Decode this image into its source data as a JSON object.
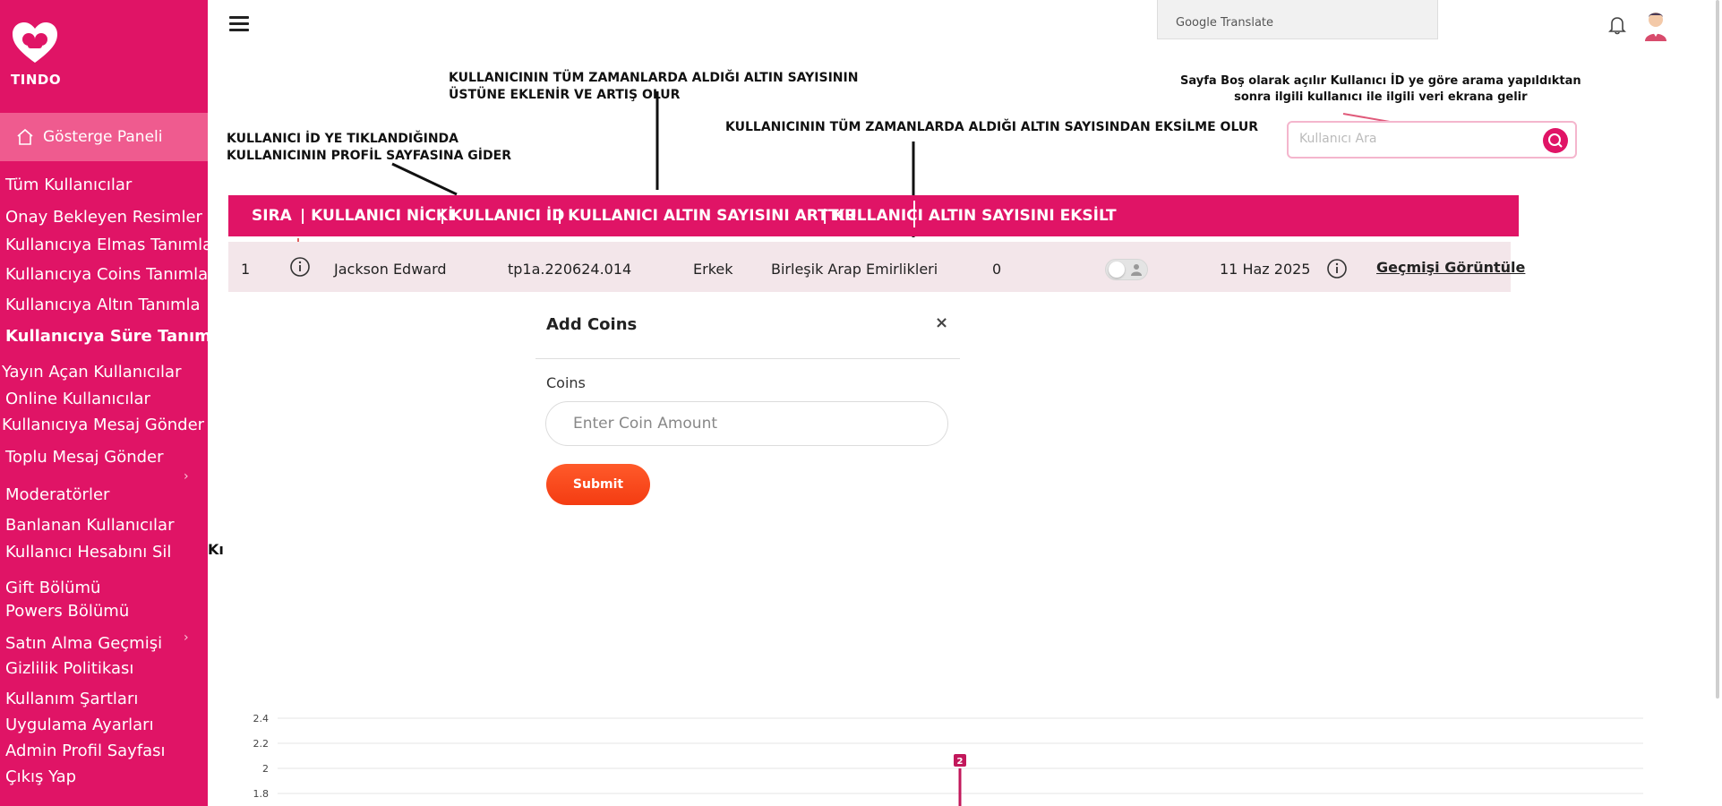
{
  "app": {
    "brand": "TINDO"
  },
  "sidebar": {
    "active_label": "Gösterge Paneli",
    "items": [
      "Tüm Kullanıcılar",
      "Onay Bekleyen Resimler",
      "Kullanıcıya Elmas Tanımla",
      "Kullanıcıya Coins Tanımla",
      "Kullanıcıya Altın Tanımla",
      "Kullanıcıya Süre Tanımla",
      "Yayın Açan Kullanıcılar",
      "Online Kullanıcılar",
      "Kullanıcıya Mesaj Gönder",
      "Toplu Mesaj Gönder",
      "Moderatörler",
      "Banlanan Kullanıcılar",
      "Kullanıcı Hesabını Sil",
      "Gift Bölümü",
      "Powers Bölümü",
      "Satın Alma Geçmişi",
      "Gizlilik Politikası",
      "Kullanım Şartları",
      "Uygulama Ayarları",
      "Admin Profil Sayfası",
      "Çıkış Yap"
    ]
  },
  "topbar": {
    "translate_label": "Google Translate"
  },
  "annotations": {
    "profile_1": "KULLANICI İD YE TIKLANDIĞINDA",
    "profile_2": "KULLANICININ PROFİL SAYFASINA GİDER",
    "increase_1": "KULLANICININ TÜM ZAMANLARDA ALDIĞI ALTIN SAYISININ",
    "increase_2": "ÜSTÜNE EKLENİR VE ARTIŞ OLUR",
    "decrease": "KULLANICININ TÜM ZAMANLARDA ALDIĞI ALTIN SAYISINDAN  EKSİLME OLUR",
    "search_1": "Sayfa Boş olarak açılır  Kullanıcı İD ye göre arama yapıldıktan",
    "search_2": "sonra ilgili kullanıcı ile ilgili veri ekrana gelir"
  },
  "search": {
    "placeholder": "Kullanıcı Ara"
  },
  "table": {
    "headers": {
      "sira": "SIRA",
      "nick": "| KULLANICI NİCKİ",
      "id": "| KULLANICI İD",
      "increase": "| KULLANICI ALTIN SAYISINI  ARTTIR",
      "decrease": "| KULLANICI ALTIN SAYISINI  EKSİLT"
    },
    "row": {
      "index": "1",
      "name": "Jackson Edward",
      "id": "tp1a.220624.014",
      "gender": "Erkek",
      "country": "Birleşik Arap Emirlikleri",
      "count": "0",
      "date": "11 Haz 2025",
      "history_link": "Geçmişi Görüntüle"
    }
  },
  "modal": {
    "title": "Add Coins",
    "close": "×",
    "field_label": "Coins",
    "placeholder": "Enter Coin Amount",
    "submit": "Submit"
  },
  "stray_text": "Kı",
  "chart_data": {
    "type": "bar",
    "y_ticks": [
      "2.4",
      "2.2",
      "2",
      "1.8"
    ],
    "ylim": [
      1.8,
      2.4
    ],
    "values": [
      2
    ],
    "data_label": "2",
    "color": "#c2185b"
  }
}
